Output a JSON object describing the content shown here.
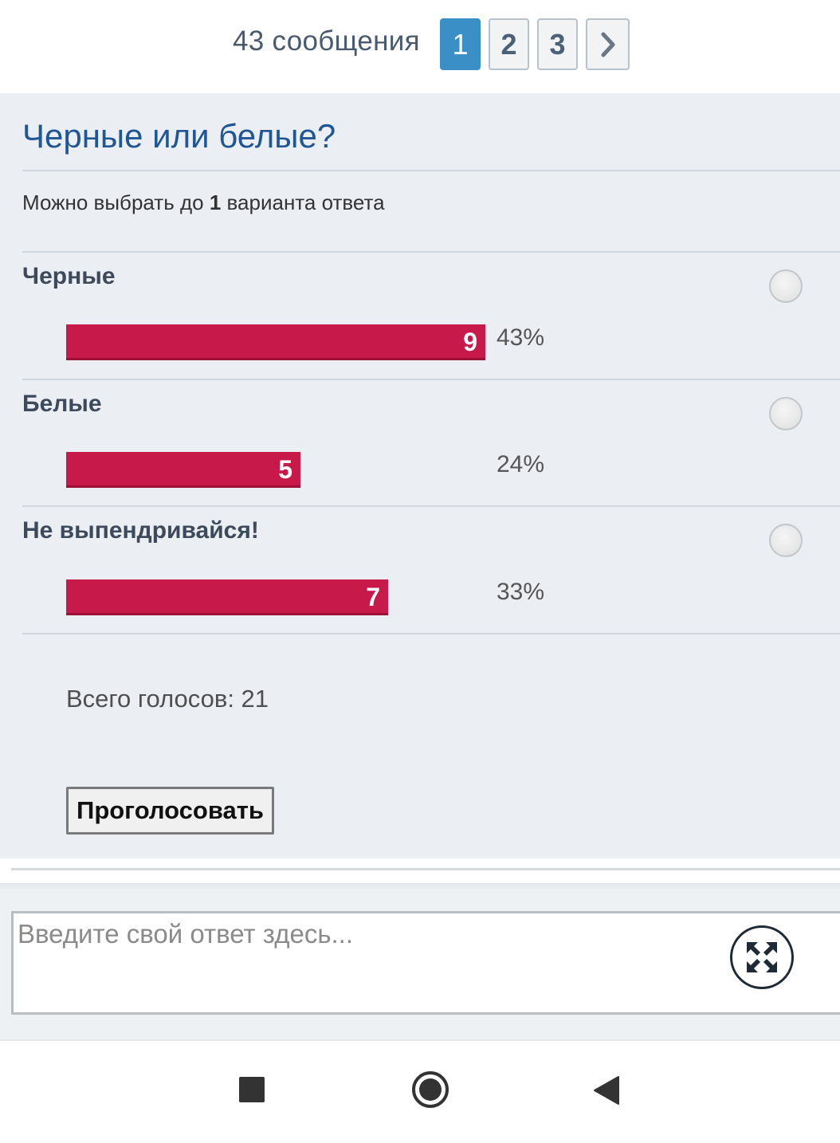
{
  "pagination": {
    "count_text": "43 сообщения",
    "pages": [
      "1",
      "2",
      "3"
    ],
    "active_page": "1",
    "next_icon": "chevron-right-icon"
  },
  "poll": {
    "title": "Черные или белые?",
    "hint_prefix": "Можно выбрать до ",
    "hint_number": "1",
    "hint_suffix": " варианта ответа",
    "bar_color": "#c7194a",
    "options": [
      {
        "label": "Черные",
        "votes": "9",
        "percent": "43%",
        "share": 0.43
      },
      {
        "label": "Белые",
        "votes": "5",
        "percent": "24%",
        "share": 0.24
      },
      {
        "label": "Не выпендривайся!",
        "votes": "7",
        "percent": "33%",
        "share": 0.33
      }
    ],
    "total_text": "Всего голосов: 21",
    "vote_button": "Проголосовать"
  },
  "reply": {
    "placeholder": "Введите свой ответ здесь...",
    "expand_icon": "expand-icon"
  },
  "navbar": {
    "recents_icon": "square-icon",
    "home_icon": "circle-icon",
    "back_icon": "triangle-back-icon"
  }
}
